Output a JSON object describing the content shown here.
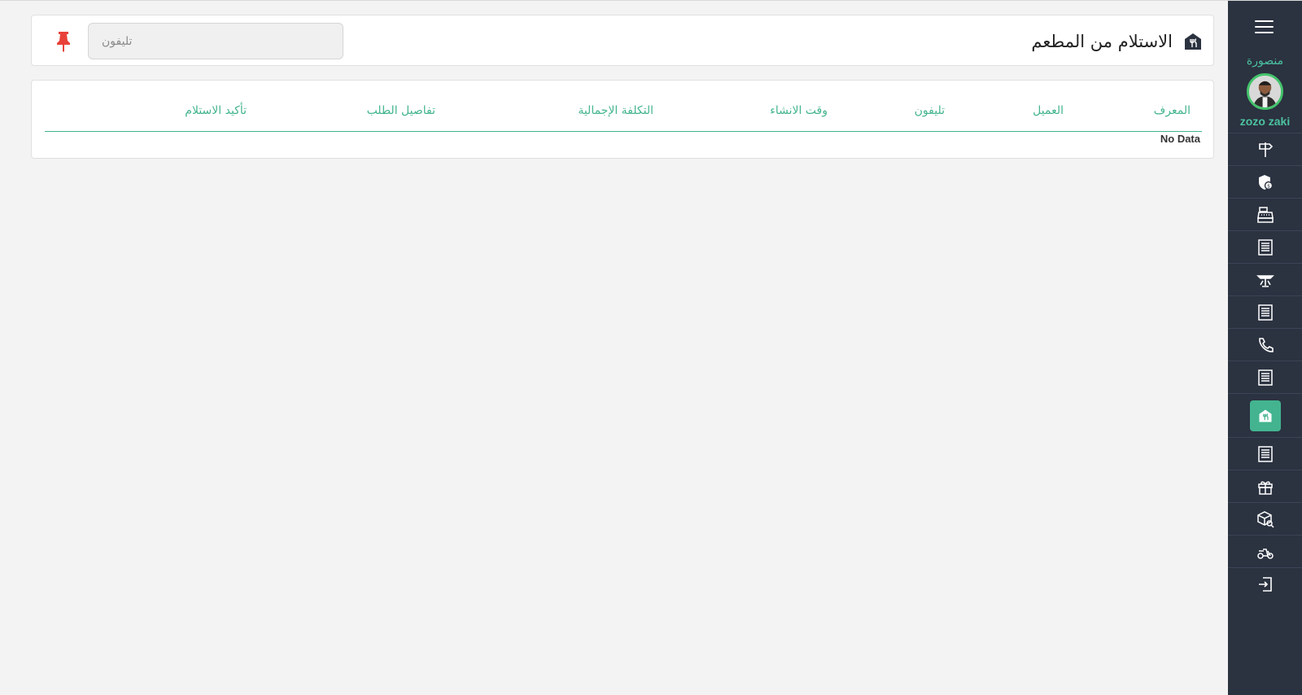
{
  "sidebar": {
    "branch_name": "منصورة",
    "user_name": "zozo zaki",
    "items": [
      {
        "icon": "signpost-icon"
      },
      {
        "icon": "shield-dollar-icon"
      },
      {
        "icon": "cash-register-icon"
      },
      {
        "icon": "receipt-icon"
      },
      {
        "icon": "table-icon"
      },
      {
        "icon": "receipt-icon"
      },
      {
        "icon": "phone-icon"
      },
      {
        "icon": "receipt-icon"
      },
      {
        "icon": "restaurant-pickup-icon",
        "active": true
      },
      {
        "icon": "receipt-icon"
      },
      {
        "icon": "gift-icon"
      },
      {
        "icon": "box-search-icon"
      },
      {
        "icon": "delivery-scooter-icon"
      },
      {
        "icon": "logout-icon"
      }
    ]
  },
  "header": {
    "title": "الاستلام من المطعم",
    "phone_placeholder": "تليفون"
  },
  "table": {
    "columns": [
      "المعرف",
      "العميل",
      "تليفون",
      "وقت الانشاء",
      "التكلفة الإجمالية",
      "تفاصيل الطلب",
      "تأكيد الاستلام"
    ],
    "empty_text": "No Data"
  },
  "colors": {
    "accent": "#43b48f",
    "sidebar_bg": "#2b3240",
    "pin": "#e8413a"
  }
}
